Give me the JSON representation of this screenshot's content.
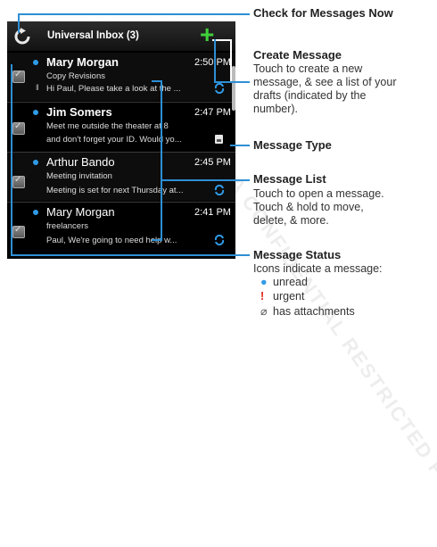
{
  "watermark": "MOTOROLA CONFIDENTIAL RESTRICTED FORMAT",
  "header": {
    "title": "Universal Inbox (3)"
  },
  "messages": [
    {
      "sender": "Mary Morgan",
      "time": "2:50 PM",
      "subject": "Copy Revisions",
      "preview": "Hi Paul, Please take a look at the ...",
      "unread": true,
      "bold": true,
      "attachment": true,
      "status_icon": "sync-icon"
    },
    {
      "sender": "Jim Somers",
      "time": "2:47 PM",
      "subject": "Meet me outside the theater at 8",
      "preview": "and don't forget your ID. Would yo...",
      "unread": true,
      "bold": true,
      "attachment": false,
      "status_icon": "message-type-icon"
    },
    {
      "sender": "Arthur Bando",
      "time": "2:45 PM",
      "subject": "Meeting invitation",
      "preview": "Meeting is set for next Thursday at...",
      "unread": true,
      "bold": false,
      "attachment": false,
      "status_icon": "sync-icon"
    },
    {
      "sender": "Mary Morgan",
      "time": "2:41 PM",
      "subject": "freelancers",
      "preview": "Paul, We're going to need help w...",
      "unread": true,
      "bold": false,
      "attachment": false,
      "status_icon": "sync-icon"
    }
  ],
  "callouts": {
    "check": {
      "title": "Check for Messages Now"
    },
    "create": {
      "title": "Create Message",
      "line1": "Touch to create a new",
      "line2": "message, & see a list of your",
      "line3": "drafts (indicated by the",
      "line4": "number)."
    },
    "msgtype": {
      "title": "Message Type"
    },
    "list": {
      "title": "Message List",
      "line1": "Touch to open a message.",
      "line2": "Touch & hold to move,",
      "line3": "delete, & more."
    },
    "status": {
      "title": "Message Status",
      "line1": "Icons indicate a message:",
      "legend": [
        {
          "icon": "unread-dot-icon",
          "glyph": "●",
          "color": "#2f9be8",
          "label": "unread"
        },
        {
          "icon": "urgent-icon",
          "glyph": "!",
          "color": "#e0201b",
          "label": "urgent"
        },
        {
          "icon": "attachment-icon",
          "glyph": "⌀",
          "color": "#555555",
          "label": "has attachments"
        }
      ]
    }
  },
  "colors": {
    "accent_blue": "#2e8fd4",
    "create_green": "#3fd13a"
  }
}
